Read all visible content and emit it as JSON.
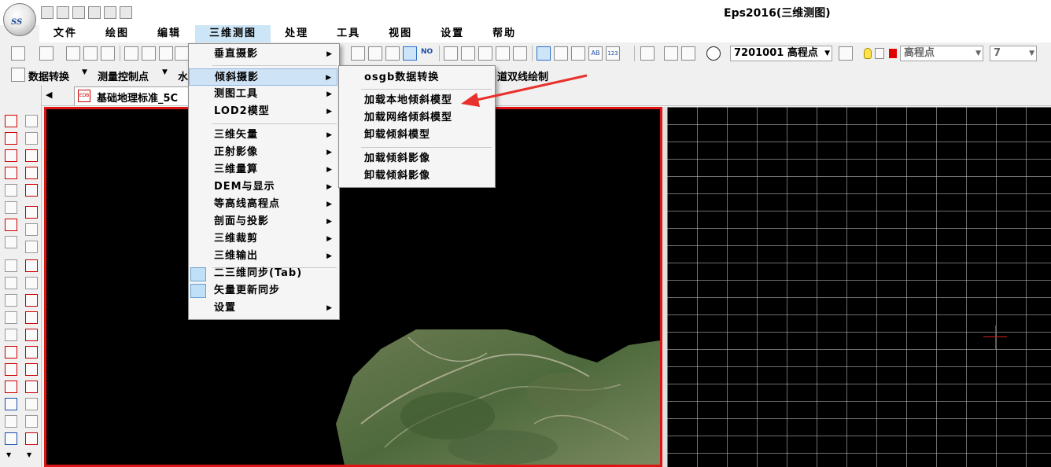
{
  "app": {
    "logo_text": "SS",
    "window_title": "Eps2016(三维测图)"
  },
  "menubar": {
    "items": [
      {
        "label": "文件"
      },
      {
        "label": "绘图"
      },
      {
        "label": "编辑"
      },
      {
        "label": "三维测图"
      },
      {
        "label": "处理"
      },
      {
        "label": "工具"
      },
      {
        "label": "视图"
      },
      {
        "label": "设置"
      },
      {
        "label": "帮助"
      }
    ]
  },
  "toolbar1": {
    "code_combo": "7201001 高程点",
    "layer_combo": "高程点",
    "width_combo": "7",
    "ab_label": "AB",
    "num_label": "123",
    "no_label": "NO"
  },
  "toolbar2": {
    "data_convert": "数据转换",
    "survey_control": "测量控制点",
    "water": "水",
    "road_label": "道双线绘制"
  },
  "doc_tabs": {
    "active_tab": "基础地理标准_5C",
    "tab_icon": "EDB"
  },
  "menu_3d": {
    "items": [
      {
        "label": "垂直摄影",
        "sub": true
      },
      {
        "label": "倾斜摄影",
        "sub": true,
        "highlighted": true
      },
      {
        "label": "测图工具",
        "sub": true
      },
      {
        "label": "LOD2模型",
        "sub": true
      },
      {
        "label": "三维矢量",
        "sub": true
      },
      {
        "label": "正射影像",
        "sub": true
      },
      {
        "label": "三维量算",
        "sub": true
      },
      {
        "label": "DEM与显示",
        "sub": true
      },
      {
        "label": "等高线高程点",
        "sub": true
      },
      {
        "label": "剖面与投影",
        "sub": true
      },
      {
        "label": "三维裁剪",
        "sub": true
      },
      {
        "label": "三维输出",
        "sub": true
      },
      {
        "label": "二三维同步(Tab)",
        "sub": false,
        "checked": true
      },
      {
        "label": "矢量更新同步",
        "sub": false,
        "checked": true
      },
      {
        "label": "设置",
        "sub": true
      }
    ]
  },
  "menu_oblique": {
    "items": [
      {
        "label": "osgb数据转换"
      },
      {
        "label": "加载本地倾斜模型"
      },
      {
        "label": "加载网络倾斜模型"
      },
      {
        "label": "卸载倾斜模型"
      },
      {
        "label": "加载倾斜影像"
      },
      {
        "label": "卸载倾斜影像"
      }
    ]
  },
  "colors": {
    "accent": "#cde6f7",
    "viewport_border": "#e01414",
    "annotation_arrow": "#e8302c",
    "crosshair": "#d02020"
  }
}
